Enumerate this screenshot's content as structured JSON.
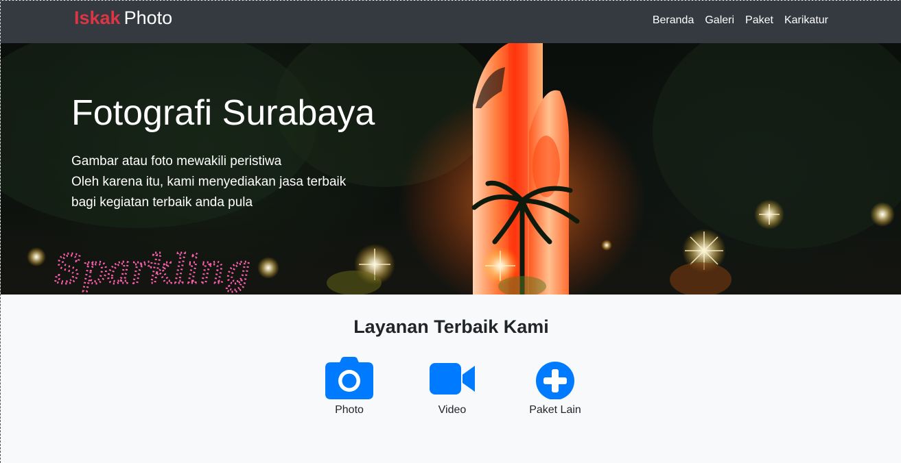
{
  "brand": {
    "accent": "Iskak",
    "rest": "Photo"
  },
  "nav": [
    "Beranda",
    "Galeri",
    "Paket",
    "Karikatur"
  ],
  "hero": {
    "title": "Fotografi Surabaya",
    "lines": [
      "Gambar atau foto mewakili peristiwa",
      "Oleh karena itu, kami menyediakan jasa terbaik",
      "bagi kegiatan terbaik anda pula"
    ],
    "sign_text": "Sparkling"
  },
  "services": {
    "title": "Layanan Terbaik Kami",
    "items": [
      {
        "label": "Photo",
        "icon": "camera-icon"
      },
      {
        "label": "Video",
        "icon": "video-camera-icon"
      },
      {
        "label": "Paket Lain",
        "icon": "plus-circle-icon"
      }
    ]
  },
  "colors": {
    "navbar_bg": "#343a40",
    "brand_accent": "#dc3545",
    "icon_blue": "#007bff",
    "page_bg": "#f8f9fa"
  }
}
